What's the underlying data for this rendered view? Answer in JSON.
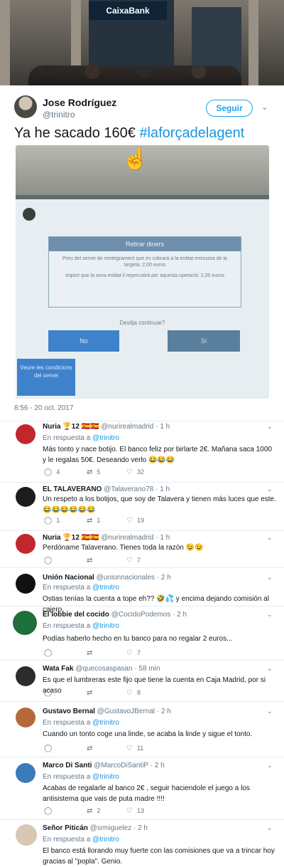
{
  "hero": {
    "bank_sign": "CaixaBank"
  },
  "tweet": {
    "name": "Jose Rodríguez",
    "handle": "@trinitro",
    "follow_label": "Seguir",
    "text": "Ya he sacado 160€ ",
    "hashtag": "#laforçadelagent",
    "timestamp": "8:56 - 20 oct. 2017",
    "atm": {
      "dialog_title": "Retirar diners",
      "line1": "Preu del servei de reintegrament que es cobrarà a la entitat emissora de la targeta: 2,00 euros",
      "line2": "Import que la seva entitat li repercutirà per aquesta operació: 2,00 euros",
      "question": "Desitja continuar?",
      "no_label": "No",
      "si_label": "Sí",
      "conditions_label": "Veure les condicions del servei"
    }
  },
  "replies": [
    {
      "name": "Nuria 🏆12 🇪🇸🇪🇸",
      "handle": "@nurirealmadrid · 1 h",
      "respuesta": "En respuesta a ",
      "to": "@trinitro",
      "text": "Más tonto y nace botijo. El banco feliz por birlarte 2€. Mañana saca 1000 y le regalas 50€. Deseando verlo 😂😂😂",
      "replies": "4",
      "retweets": "5",
      "likes": "32"
    },
    {
      "name": "EL TALAVERANO",
      "handle": "@Talaverano78 · 1 h",
      "respuesta": "",
      "to": "",
      "text": "Un respeto a los botijos, que soy de Talavera y tienen más luces que este. 😂😂😂😂😂😂",
      "replies": "1",
      "retweets": "1",
      "likes": "19"
    },
    {
      "name": "Nuria 🏆12 🇪🇸🇪🇸",
      "handle": "@nurirealmadrid · 1 h",
      "respuesta": "",
      "to": "",
      "text": "Perdóname Talaverano. Tienes toda la razón 😉😉",
      "replies": "",
      "retweets": "",
      "likes": "7"
    },
    {
      "name": "Unión Nacional",
      "handle": "@unionnacionales · 2 h",
      "respuesta": "En respuesta a ",
      "to": "@trinitro",
      "text": "Ostias tenías la cuenta a tope eh?? 🤣💦 y encima dejando comisión al cajero.",
      "replies": "",
      "retweets": "",
      "likes": ""
    },
    {
      "name": "El lobbie del cocido",
      "handle": "@CocidoPodemos · 2 h",
      "respuesta": "En respuesta a ",
      "to": "@trinitro",
      "text": "Podías haberlo hecho en tu banco para no regalar 2 euros...",
      "replies": "",
      "retweets": "",
      "likes": "7"
    },
    {
      "name": "Wata Fak",
      "handle": "@quecosaspasan · 58 min",
      "respuesta": "",
      "to": "",
      "text": "Es que el lumbreras este fijo que tiene la cuenta en Caja Madrid, por si acaso",
      "replies": "",
      "retweets": "",
      "likes": "8"
    },
    {
      "name": "Gustavo Bernal",
      "handle": "@GustavoJBernal · 2 h",
      "respuesta": "En respuesta a ",
      "to": "@trinitro",
      "text": "Cuando un tonto coge una linde, se acaba la linde y sigue el tonto.",
      "replies": "",
      "retweets": "",
      "likes": "11"
    },
    {
      "name": "Marco Di Santi",
      "handle": "@MarcoDiSantiP · 2 h",
      "respuesta": "En respuesta a ",
      "to": "@trinitro",
      "text": "Acabas de regalarle al banco 2€ , seguir haciendole el juego a los antisistema que vais de puta madre !!!!",
      "replies": "",
      "retweets": "2",
      "likes": "13"
    },
    {
      "name": "Señor Piticán",
      "handle": "@srmiguelez · 2 h",
      "respuesta": "En respuesta a ",
      "to": "@trinitro",
      "text": "El banco está llorando muy fuerte con las comisiones que va a trincar hoy gracias al \"popla\". Genio.",
      "replies": "",
      "retweets": "",
      "likes": ""
    }
  ]
}
